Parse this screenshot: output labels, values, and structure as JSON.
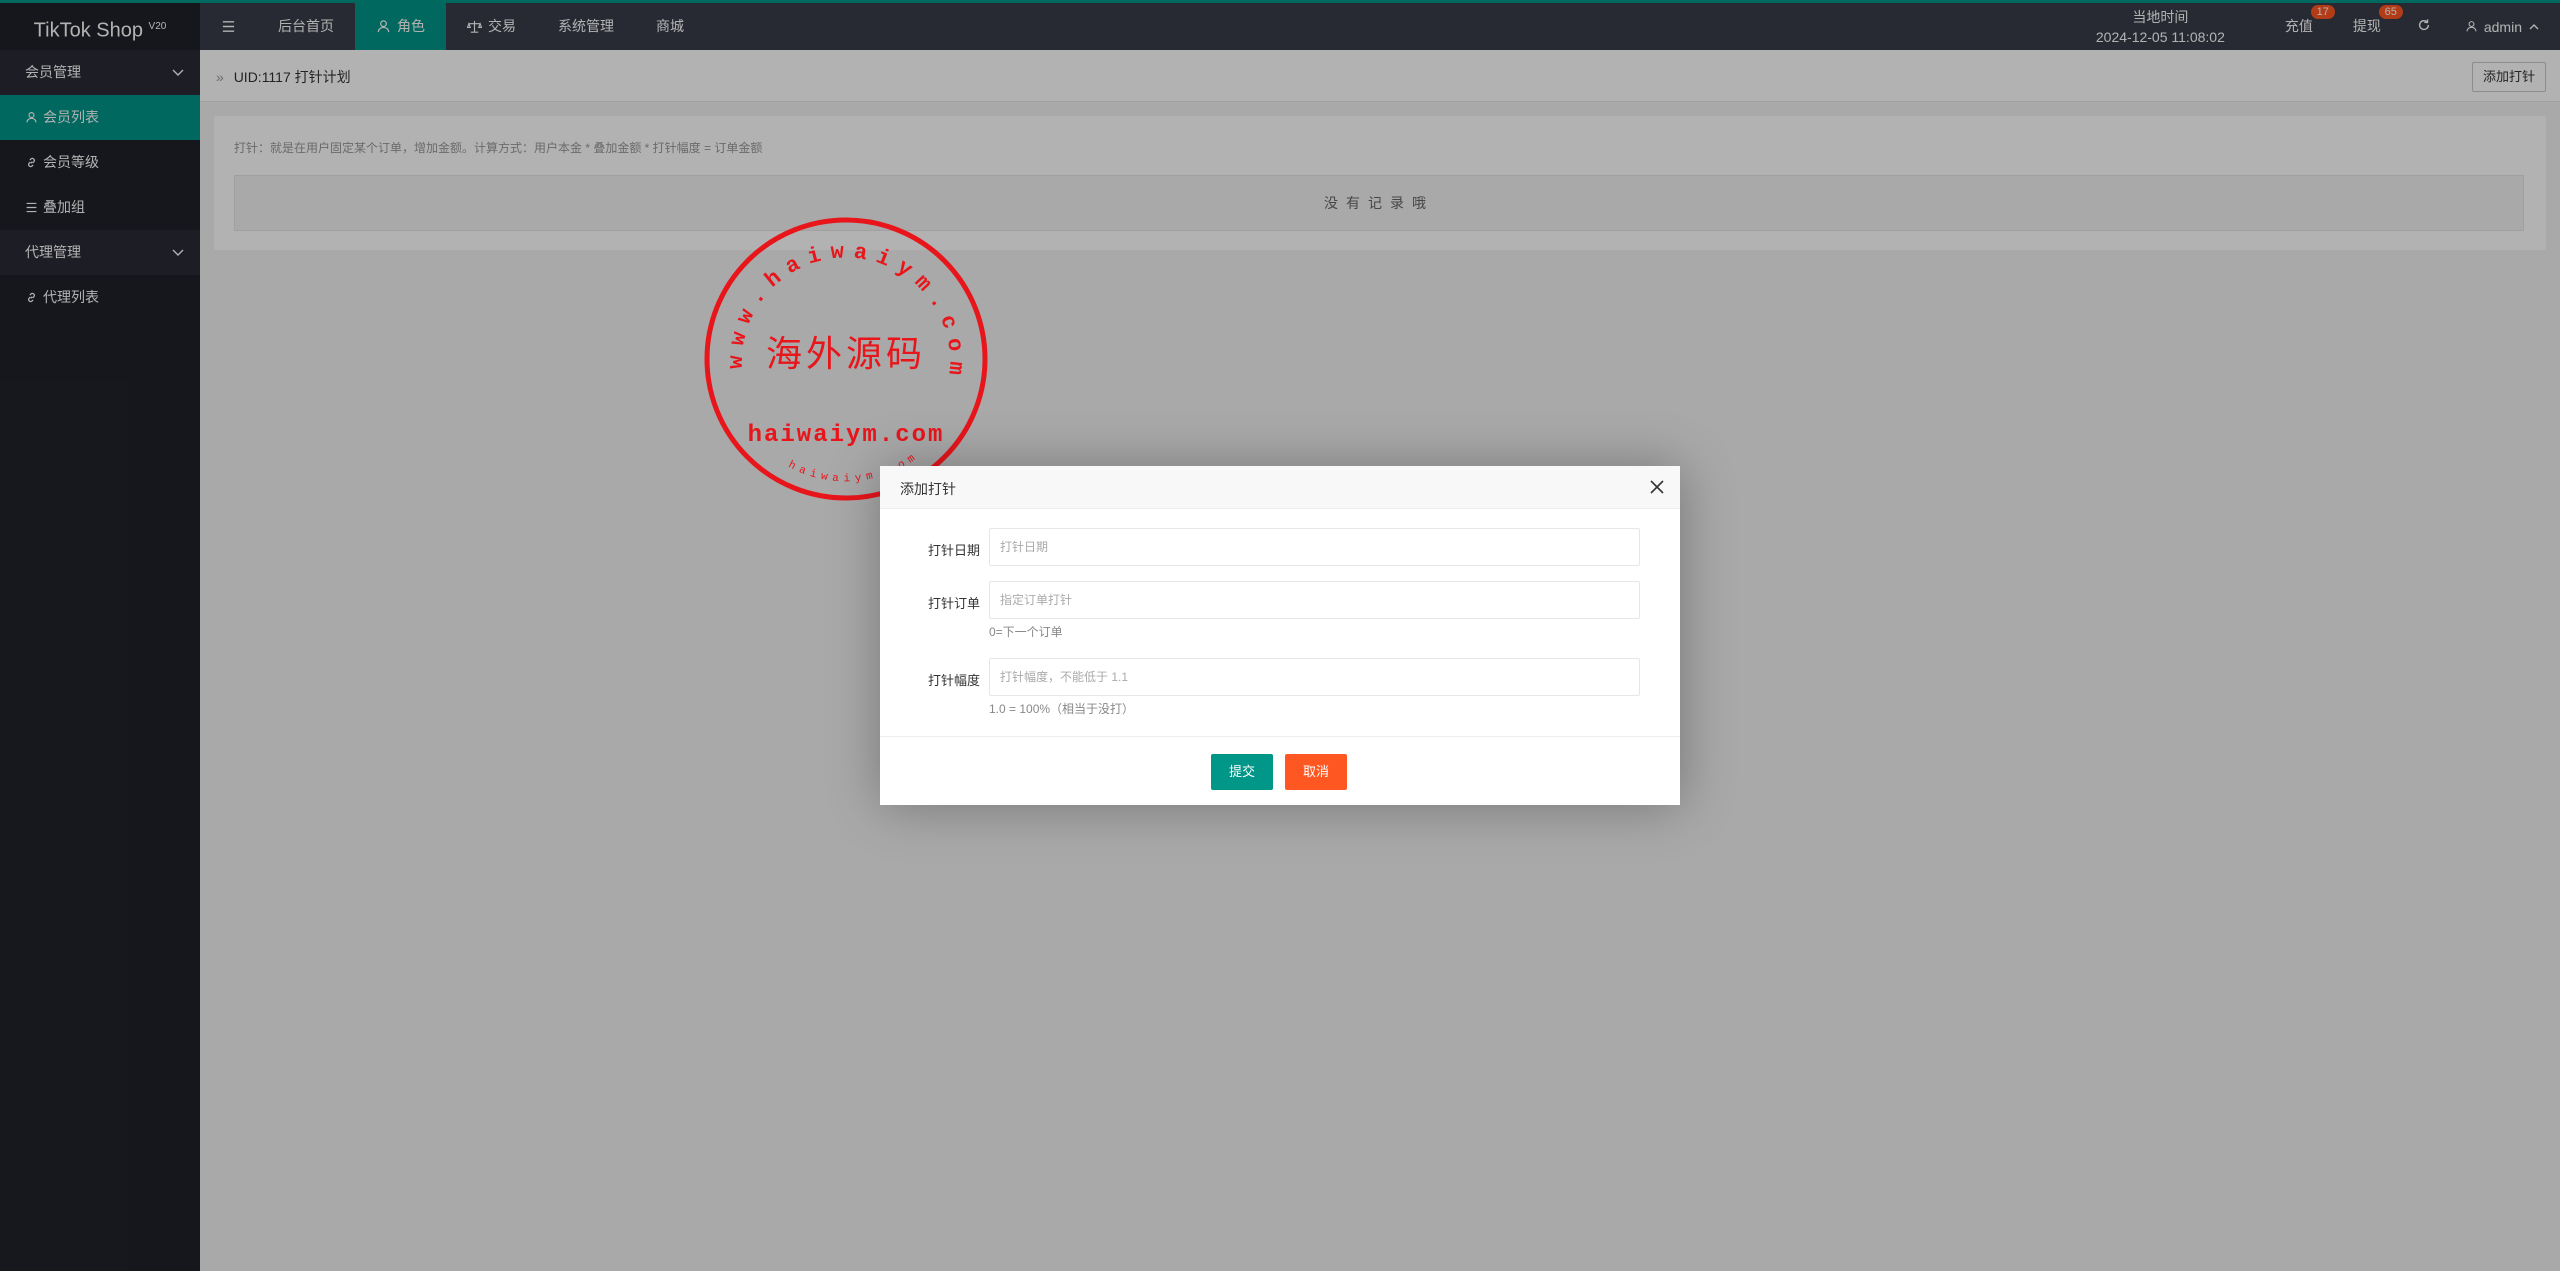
{
  "app": {
    "title": "TikTok Shop",
    "version": "V20"
  },
  "topnav": {
    "menu_icon": "hamburger-icon",
    "items": [
      {
        "label": "后台首页",
        "icon": ""
      },
      {
        "label": "角色",
        "icon": "user-icon",
        "active": true
      },
      {
        "label": "交易",
        "icon": "scale-icon"
      },
      {
        "label": "系统管理",
        "icon": ""
      },
      {
        "label": "商城",
        "icon": ""
      }
    ]
  },
  "header_right": {
    "time_label": "当地时间",
    "time_value": "2024-12-05 11:08:02",
    "recharge_label": "充值",
    "recharge_badge": "17",
    "withdraw_label": "提现",
    "withdraw_badge": "65",
    "refresh_icon": "refresh-icon",
    "user_label": "admin"
  },
  "sidebar": {
    "groups": [
      {
        "label": "会员管理",
        "items": [
          {
            "label": "会员列表",
            "icon": "user-icon",
            "active": true
          },
          {
            "label": "会员等级",
            "icon": "link-icon"
          },
          {
            "label": "叠加组",
            "icon": "list-icon"
          }
        ]
      },
      {
        "label": "代理管理",
        "items": [
          {
            "label": "代理列表",
            "icon": "link-icon"
          }
        ]
      }
    ]
  },
  "breadcrumb": {
    "arrow": "»",
    "text": "UID:1117 打针计划"
  },
  "add_button": "添加打针",
  "tip": "打针：就是在用户固定某个订单，增加金额。计算方式：用户本金 * 叠加金额 * 打针幅度 = 订单金额",
  "empty_text": "没有记录哦",
  "watermark": {
    "center": "海外源码",
    "domain": "haiwaiym.com",
    "ring_top": "www.haiwaiym.com",
    "ring_bottom": "haiwaiym.com"
  },
  "modal": {
    "title": "添加打针",
    "fields": [
      {
        "label": "打针日期",
        "placeholder": "打针日期",
        "value": "",
        "hint": ""
      },
      {
        "label": "打针订单",
        "placeholder": "指定订单打针",
        "value": "",
        "hint": "0=下一个订单"
      },
      {
        "label": "打针幅度",
        "placeholder": "打针幅度，不能低于 1.1",
        "value": "",
        "hint": "1.0 = 100%（相当于没打）"
      }
    ],
    "submit_label": "提交",
    "cancel_label": "取消"
  },
  "colors": {
    "accent": "#009688",
    "danger": "#ff5722",
    "header": "#393d49",
    "sidebar": "#20222a",
    "stamp": "#e8151b"
  }
}
